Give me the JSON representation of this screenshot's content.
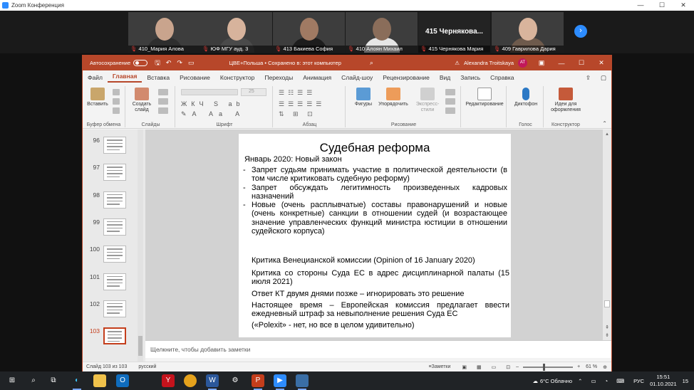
{
  "zoom": {
    "title": "Zoom Конференция",
    "participants": [
      {
        "name": "410_Мария Алова",
        "skin": "#c9a48d",
        "shirt": "#2e2e2e"
      },
      {
        "name": "ЮФ МГУ ауд. 3",
        "skin": "#d7b39c",
        "shirt": "#4a4a4a"
      },
      {
        "name": "413 Бакиева София",
        "skin": "#a07a63",
        "shirt": "#1d1d1d"
      },
      {
        "name": "410 Алоян Михаил",
        "skin": "#8a6d5a",
        "shirt": "#e6e6e6"
      },
      {
        "name": "415 Чернякова Мария",
        "big": "415 Чернякова..."
      },
      {
        "name": "409 Гаврилова Дария",
        "skin": "#d9b49c",
        "shirt": "#6e5a4c"
      }
    ],
    "next": "›"
  },
  "ppt": {
    "autosave": "Автосохранение",
    "doc": "ЦВЕ+Польша • Сохранено в: этот компьютер",
    "user": "Alexandra Troitskaya",
    "initials": "AT",
    "tabs": [
      "Файл",
      "Главная",
      "Вставка",
      "Рисование",
      "Конструктор",
      "Переходы",
      "Анимация",
      "Слайд-шоу",
      "Рецензирование",
      "Вид",
      "Запись",
      "Справка"
    ],
    "groups": {
      "clipboard": "Буфер обмена",
      "slides": "Слайды",
      "font": "Шрифт",
      "para": "Абзац",
      "draw": "Рисование",
      "voice": "Голос",
      "designer": "Конструктор"
    },
    "buttons": {
      "paste": "Вставить",
      "new_slide": "Создать слайд",
      "shapes": "Фигуры",
      "arrange": "Упорядочить",
      "styles": "Экспресс-стили",
      "edit": "Редактирование",
      "dictate": "Диктофон",
      "ideas": "Идеи для оформления"
    },
    "font_size": "25",
    "thumbnails": [
      "96",
      "97",
      "98",
      "99",
      "100",
      "101",
      "102",
      "103"
    ],
    "slide": {
      "title": "Судебная реформа",
      "subtitle": "Январь 2020: Новый закон",
      "bullets": [
        "Запрет судьям принимать участие в политической деятельности (в том числе критиковать судебную реформу)",
        "Запрет обсуждать легитимность произведенных кадровых назначений",
        "Новые (очень расплывчатые) составы правонарушений и новые (очень конкретные) санкции в отношении судей (и возрастающее значение управленческих функций министра юстиции в отношении судейского корпуса)"
      ],
      "critique": [
        "Критика Венецианской комиссии (Opinion of 16 January 2020)",
        "Критика со стороны Суда ЕС в адрес дисциплинарной палаты (15 июля 2021)",
        "Ответ КТ двумя днями позже – игнорировать это решение",
        "Настоящее время – Европейская комиссия предлагает ввести ежедневный штраф за невыполнение решения Суда ЕС",
        "(«Polexit» - нет, но все в целом удивительно)"
      ]
    },
    "notes": "Щелкните, чтобы добавить заметки",
    "status": {
      "slide": "Слайд 103 из 103",
      "lang": "русский",
      "notes_btn": "Заметки",
      "zoom": "61 %"
    }
  },
  "taskbar": {
    "weather": "6°C Облачно",
    "lang": "РУС",
    "time": "15:51",
    "date": "01.10.2021",
    "badge": "15"
  }
}
